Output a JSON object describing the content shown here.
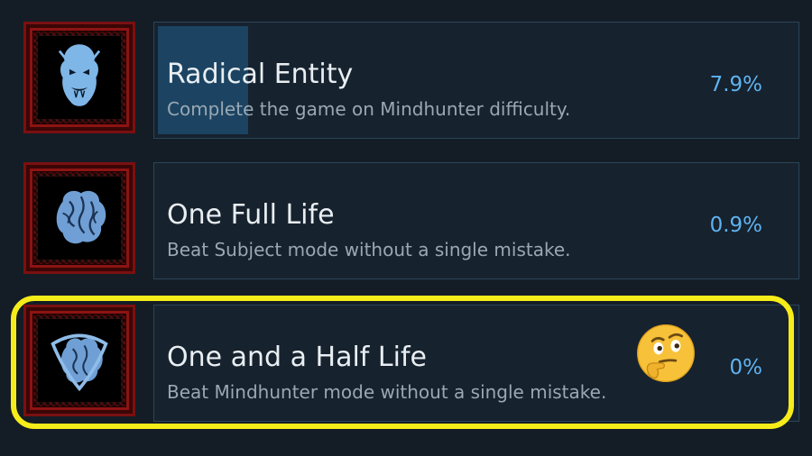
{
  "achievements": [
    {
      "icon": "demon-face-icon",
      "title": "Radical Entity",
      "description": "Complete the game on Mindhunter difficulty.",
      "percent_label": "7.9%",
      "unlock_percent": 7.9
    },
    {
      "icon": "brain-icon",
      "title": "One Full Life",
      "description": "Beat Subject mode without a single mistake.",
      "percent_label": "0.9%",
      "unlock_percent": 0.9
    },
    {
      "icon": "brain-knot-icon",
      "title": "One and a Half Life",
      "description": "Beat Mindhunter mode without a single mistake.",
      "percent_label": "0%",
      "unlock_percent": 0
    }
  ],
  "overlay": {
    "highlight_color": "#f6ec1a",
    "emoji_icon": "thinking-face-icon"
  },
  "colors": {
    "background": "#141d26",
    "card_background": "#16222e",
    "card_border": "#2a4558",
    "progress_fill": "#1c4462",
    "percent_text": "#5fb3f0",
    "icon_frame": "#8d1313"
  }
}
